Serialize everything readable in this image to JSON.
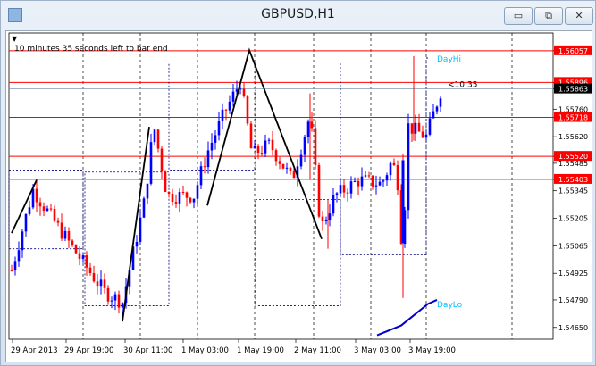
{
  "window": {
    "title": "GBPUSD,H1",
    "buttons": {
      "minimize": "▭",
      "restore": "⧉",
      "close": "✕"
    }
  },
  "status": {
    "time_left": "10 minutes 35 seconds left to bar end",
    "countdown": "<10:35"
  },
  "chart_data": {
    "type": "candlestick",
    "symbol": "GBPUSD",
    "timeframe": "H1",
    "ylim": [
      1.5459,
      1.5612
    ],
    "y_ticks": [
      "1.56057",
      "1.55896",
      "1.55863",
      "1.55760",
      "1.55718",
      "1.55620",
      "1.55520",
      "1.55485",
      "1.55403",
      "1.55345",
      "1.55205",
      "1.55065",
      "1.54925",
      "1.54790",
      "1.54650"
    ],
    "x_ticks": [
      "29 Apr 2013",
      "29 Apr 19:00",
      "30 Apr 11:00",
      "1 May 03:00",
      "1 May 19:00",
      "2 May 11:00",
      "3 May 03:00",
      "3 May 19:00"
    ],
    "horizontal_levels": [
      1.56057,
      1.55896,
      1.55718,
      1.5552,
      1.55403
    ],
    "current_price": "1.55863",
    "labels": {
      "day_high": "DayHi",
      "day_low": "DayLo"
    },
    "colors": {
      "bull": "#0000ff",
      "bear": "#ff0000",
      "level": "#ff0000",
      "zigzag": "#000000",
      "current": "#000000",
      "dayline": "#00bfff",
      "box": "#000080"
    }
  }
}
